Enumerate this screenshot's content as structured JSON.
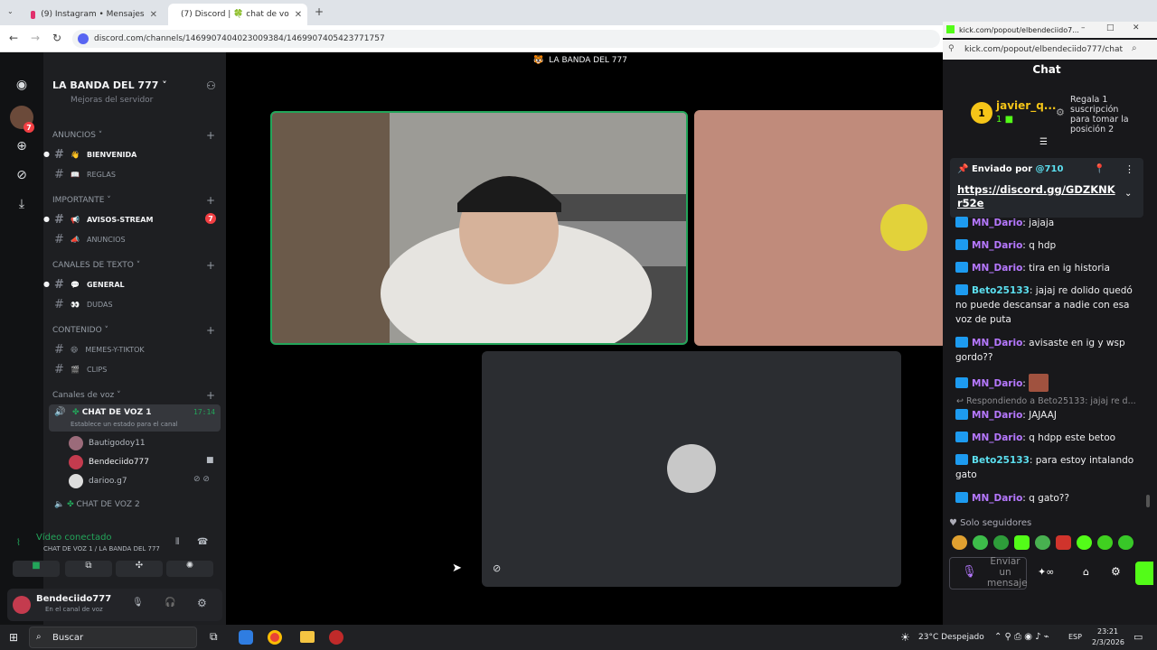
{
  "tabs": [
    {
      "label": "(9) Instagram • Mensajes",
      "active": false
    },
    {
      "label": "(7) Discord | 🍀 chat de vo",
      "active": true
    }
  ],
  "address": {
    "url": "discord.com/channels/1469907404023009384/1469907405423771757"
  },
  "server": {
    "name": "LA BANDA DEL 777",
    "banner": "LA BANDA DEL 777",
    "top_hint": "Mejoras del servidor"
  },
  "categories": [
    {
      "label": "ANUNCIOS ˅",
      "channels": [
        {
          "label": "BIENVENIDA",
          "emoji": "👋",
          "bold": true
        },
        {
          "label": "REGLAS",
          "emoji": "📖",
          "bold": false
        }
      ]
    },
    {
      "label": "IMPORTANTE ˅",
      "channels": [
        {
          "label": "AVISOS-STREAM",
          "emoji": "📢",
          "bold": true,
          "badge": "7"
        },
        {
          "label": "ANUNCIOS",
          "emoji": "📣",
          "bold": false
        }
      ]
    },
    {
      "label": "CANALES DE TEXTO ˅",
      "channels": [
        {
          "label": "GENERAL",
          "emoji": "💬",
          "bold": true
        },
        {
          "label": "DUDAS",
          "emoji": "👀",
          "bold": false
        }
      ]
    },
    {
      "label": "CONTENIDO ˅",
      "channels": [
        {
          "label": "MEMES-Y-TIKTOK",
          "emoji": "😄",
          "bold": false
        },
        {
          "label": "CLIPS",
          "emoji": "🎬",
          "bold": false
        }
      ]
    }
  ],
  "voice": {
    "category": "Canales de voz ˅",
    "channel1": "CHAT DE VOZ 1",
    "timer": "17:14",
    "status_hint": "Establece un estado para el canal",
    "users": [
      "Bautigodoy11",
      "Bendeciido777",
      "darioo.g7"
    ],
    "channel2": "CHAT DE VOZ 2"
  },
  "connection": {
    "status": "Vídeo conectado",
    "where": "CHAT DE VOZ 1 / LA BANDA DEL 777"
  },
  "me": {
    "name": "Bendeciido777",
    "status": "En el canal de voz"
  },
  "kick": {
    "window_title": "kick.com/popout/elbendeciido7...",
    "url": "kick.com/popout/elbendeciido777/chat",
    "chat_title": "Chat",
    "top_gifter": {
      "rank": "1",
      "name": "javier_q...",
      "count": "1",
      "cta": "Regala 1 suscripción para tomar la posición 2"
    },
    "pinned": {
      "by_label": "Enviado por",
      "by_user": "@710",
      "link": "https://discord.gg/GDZKNKr52e"
    },
    "messages": [
      {
        "user": "MN_Dario",
        "text": ": jajaja",
        "color": "#b678ff"
      },
      {
        "user": "MN_Dario",
        "text": ": q hdp",
        "color": "#b678ff"
      },
      {
        "user": "MN_Dario",
        "text": ": tira en ig historia",
        "color": "#b678ff"
      },
      {
        "user": "Beto25133",
        "text": ": jajaj re dolido quedó no puede descansar a nadie con esa voz de puta",
        "color": "#5ce0f0"
      },
      {
        "user": "MN_Dario",
        "text": ": avisaste en ig y wsp gordo??",
        "color": "#b678ff"
      },
      {
        "user": "MN_Dario",
        "text": ":",
        "color": "#b678ff"
      },
      {
        "user": "MN_Dario",
        "text": ": JAJAAJ",
        "color": "#b678ff",
        "reply": "Respondiendo a Beto25133: jajaj re d..."
      },
      {
        "user": "MN_Dario",
        "text": ": q hdpp este betoo",
        "color": "#b678ff"
      },
      {
        "user": "Beto25133",
        "text": ": para estoy intalando gato",
        "color": "#5ce0f0"
      },
      {
        "user": "MN_Dario",
        "text": ": q gato??",
        "color": "#b678ff"
      }
    ],
    "followers_only": "Solo seguidores",
    "send_placeholder": "Enviar un mensaje"
  },
  "taskbar": {
    "search": "Buscar",
    "weather": "23°C  Despejado",
    "lang": "ESP",
    "time": "23:21",
    "date": "2/3/2026"
  }
}
